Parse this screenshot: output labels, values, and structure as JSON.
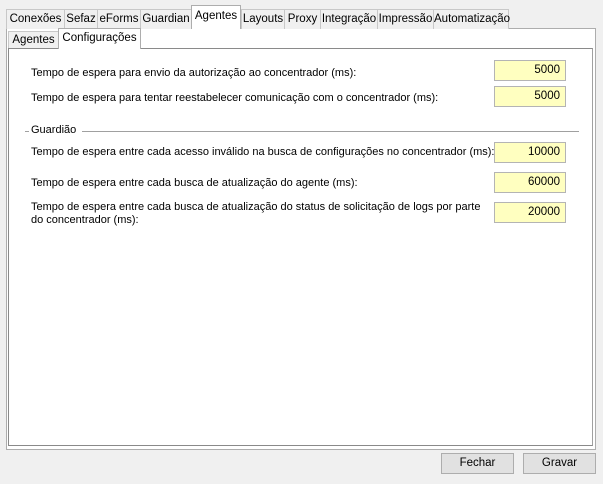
{
  "tabs": [
    "Conexões",
    "Sefaz",
    "eForms",
    "Guardian",
    "Agentes",
    "Layouts",
    "Proxy",
    "Integração",
    "Impressão",
    "Automatização"
  ],
  "subtabs": [
    "Agentes",
    "Configurações"
  ],
  "fields": [
    {
      "label": "Tempo de espera para envio da autorização ao concentrador (ms):",
      "value": "5000"
    },
    {
      "label": "Tempo de espera para tentar reestabelecer comunicação com o concentrador (ms):",
      "value": "5000"
    }
  ],
  "guardiao": {
    "title": "Guardião",
    "fields": [
      {
        "label": "Tempo de espera entre cada acesso inválido na busca de configurações no concentrador (ms):",
        "value": "10000"
      },
      {
        "label": "Tempo de espera entre cada busca de atualização do agente (ms):",
        "value": "60000"
      },
      {
        "label": "Tempo de espera entre cada busca de atualização do status de solicitação de logs por parte do concentrador (ms):",
        "value": "20000"
      }
    ]
  },
  "buttons": {
    "close": "Fechar",
    "save": "Gravar"
  }
}
